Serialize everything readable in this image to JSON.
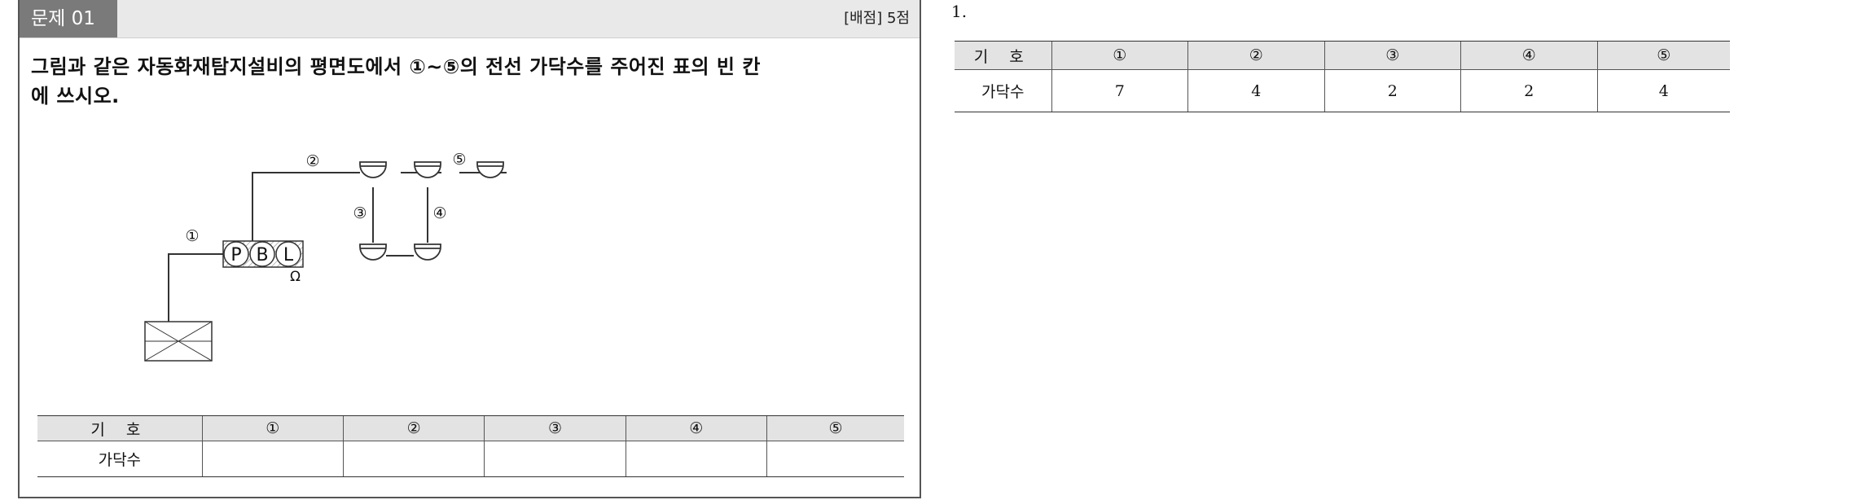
{
  "problem": {
    "badge": "문제 01",
    "score": "[배점] 5점",
    "question_line1": "그림과 같은 자동화재탐지설비의 평면도에서 ①~⑤의 전선 가닥수를 주어진 표의 빈 칸",
    "question_line2": "에 쓰시오."
  },
  "diagram": {
    "labels": {
      "wire1": "①",
      "wire2": "②",
      "wire3": "③",
      "wire4": "④",
      "wire5": "⑤",
      "p": "P",
      "b": "B",
      "l": "L",
      "omega": "Ω"
    }
  },
  "question_table": {
    "headers": [
      "기 호",
      "①",
      "②",
      "③",
      "④",
      "⑤"
    ],
    "row_label": "가닥수",
    "values": [
      "",
      "",
      "",
      "",
      ""
    ]
  },
  "answer": {
    "number": "1.",
    "headers": [
      "기 호",
      "①",
      "②",
      "③",
      "④",
      "⑤"
    ],
    "row_label": "가닥수",
    "values": [
      "7",
      "4",
      "2",
      "2",
      "4"
    ]
  }
}
